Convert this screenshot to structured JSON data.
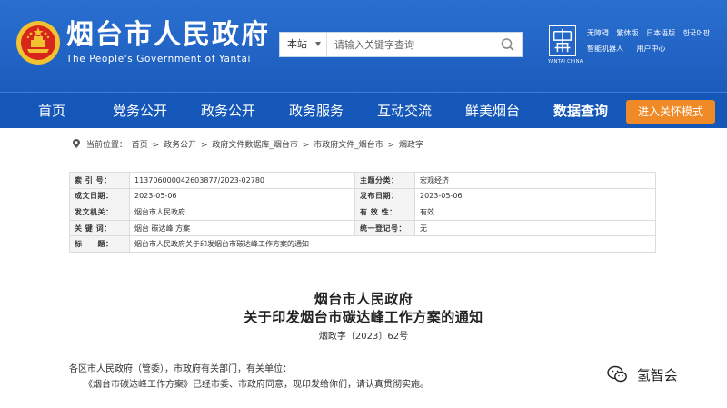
{
  "header": {
    "title": "烟台市人民政府",
    "subtitle": "The People's Government of Yantai",
    "search": {
      "scope": "本站",
      "placeholder": "请输入关键字查询"
    },
    "china_logo_caption": "YANTAI CHINA",
    "top_links_row1": [
      "无障碍",
      "繁体版",
      "日本语版",
      "한국어판"
    ],
    "top_links_row2": [
      "智能机器人",
      "用户中心"
    ]
  },
  "nav": {
    "items": [
      "首页",
      "党务公开",
      "政务公开",
      "政务服务",
      "互动交流",
      "鲜美烟台",
      "数据查询"
    ],
    "active_index": 6,
    "care_mode": "进入关怀模式"
  },
  "breadcrumb": {
    "prefix": "当前位置：",
    "items": [
      "首页",
      "政务公开",
      "政府文件数据库_烟台市",
      "市政府文件_烟台市",
      "烟政字"
    ],
    "separator": ">"
  },
  "info": {
    "rows": [
      {
        "l1": "索 引 号：",
        "v1": "11370600004260387​7/2023-02780",
        "l2": "主题分类：",
        "v2": "宏观经济"
      },
      {
        "l1": "成文日期：",
        "v1": "2023-05-06",
        "l2": "发布日期：",
        "v2": "2023-05-06"
      },
      {
        "l1": "发文机关：",
        "v1": "烟台市人民政府",
        "l2": "有 效 性：",
        "v2": "有效"
      },
      {
        "l1": "关 键 词：",
        "v1": "烟台 碳达峰 方案",
        "l2": "统一登记号：",
        "v2": "无"
      }
    ],
    "title_label": "标　　题：",
    "title_value": "烟台市人民政府关于印发烟台市碳达峰工作方案的通知"
  },
  "document": {
    "org": "烟台市人民政府",
    "title": "关于印发烟台市碳达峰工作方案的通知",
    "number": "烟政字〔2023〕62号",
    "para1": "各区市人民政府（管委），市政府有关部门，有关单位：",
    "para2": "《烟台市碳达峰工作方案》已经市委、市政府同意，现印发给你们，请认真贯彻实施。"
  },
  "watermark": "氢智会",
  "colors": {
    "header_bg": "#1e63c4",
    "nav_bg": "#1457b8",
    "care_btn": "#ef8a26"
  }
}
